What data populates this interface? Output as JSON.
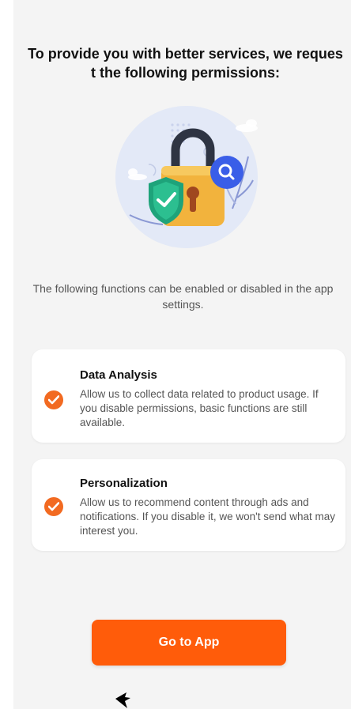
{
  "title": "To provide you with better services, we request the following permissions:",
  "illustration": {
    "icons": [
      "lock-icon",
      "shield-check-icon",
      "magnifier-icon"
    ],
    "colors": {
      "backdrop": "#dde5f5",
      "lock_body": "#f2b33d",
      "shackle": "#2e3443",
      "keyhole": "#a0471f",
      "shield": "#1ea37a",
      "search_badge": "#3a5ee8"
    }
  },
  "subtitle": "The following functions can be enabled or disabled in the app settings.",
  "cards": [
    {
      "title": "Data Analysis",
      "description": "Allow us to collect data related to product usage. If you disable permissions, basic functions are still available.",
      "checked": true,
      "icon": "check-circle-icon"
    },
    {
      "title": "Personalization",
      "description": "Allow us to recommend content through ads and notifications. If you disable it, we won't send what may interest you.",
      "checked": true,
      "icon": "check-circle-icon"
    }
  ],
  "button": {
    "label": "Go to App"
  },
  "colors": {
    "accent": "#ff5c0a",
    "check": "#f26a21",
    "background": "#f4f4f4",
    "card": "#ffffff"
  }
}
